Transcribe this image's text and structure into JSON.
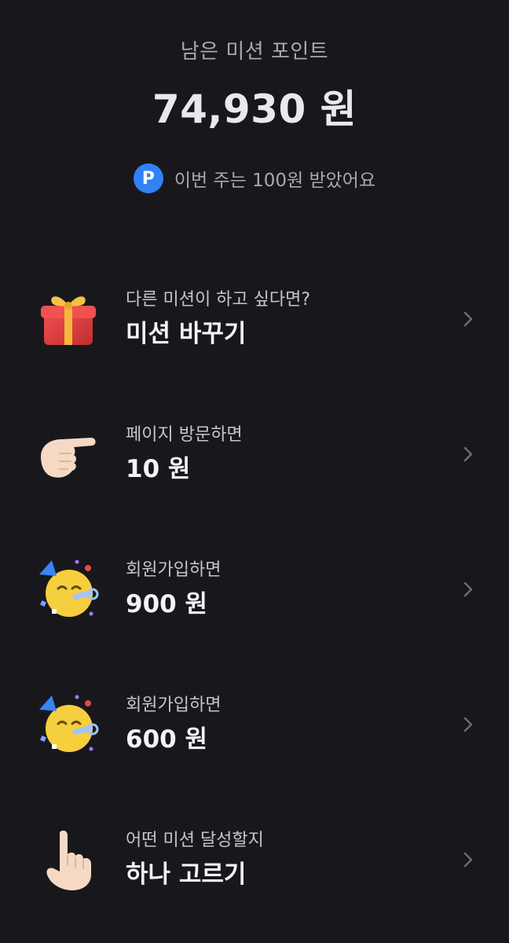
{
  "header": {
    "label": "남은 미션 포인트",
    "amount": "74,930 원",
    "earned_badge": "P",
    "earned_text": "이번 주는 100원 받았어요"
  },
  "missions": [
    {
      "icon": "gift-icon",
      "subtitle": "다른 미션이 하고 싶다면?",
      "title": "미션 바꾸기"
    },
    {
      "icon": "pointing-right-hand-icon",
      "subtitle": "페이지 방문하면",
      "title": "10 원"
    },
    {
      "icon": "party-face-icon",
      "subtitle": "회원가입하면",
      "title": "900 원"
    },
    {
      "icon": "party-face-icon",
      "subtitle": "회원가입하면",
      "title": "600 원"
    },
    {
      "icon": "pointing-up-hand-icon",
      "subtitle": "어떤 미션 달성할지",
      "title": "하나 고르기"
    }
  ],
  "colors": {
    "background": "#18181c",
    "accent": "#3182f6",
    "muted_text": "#a7a9b0"
  }
}
